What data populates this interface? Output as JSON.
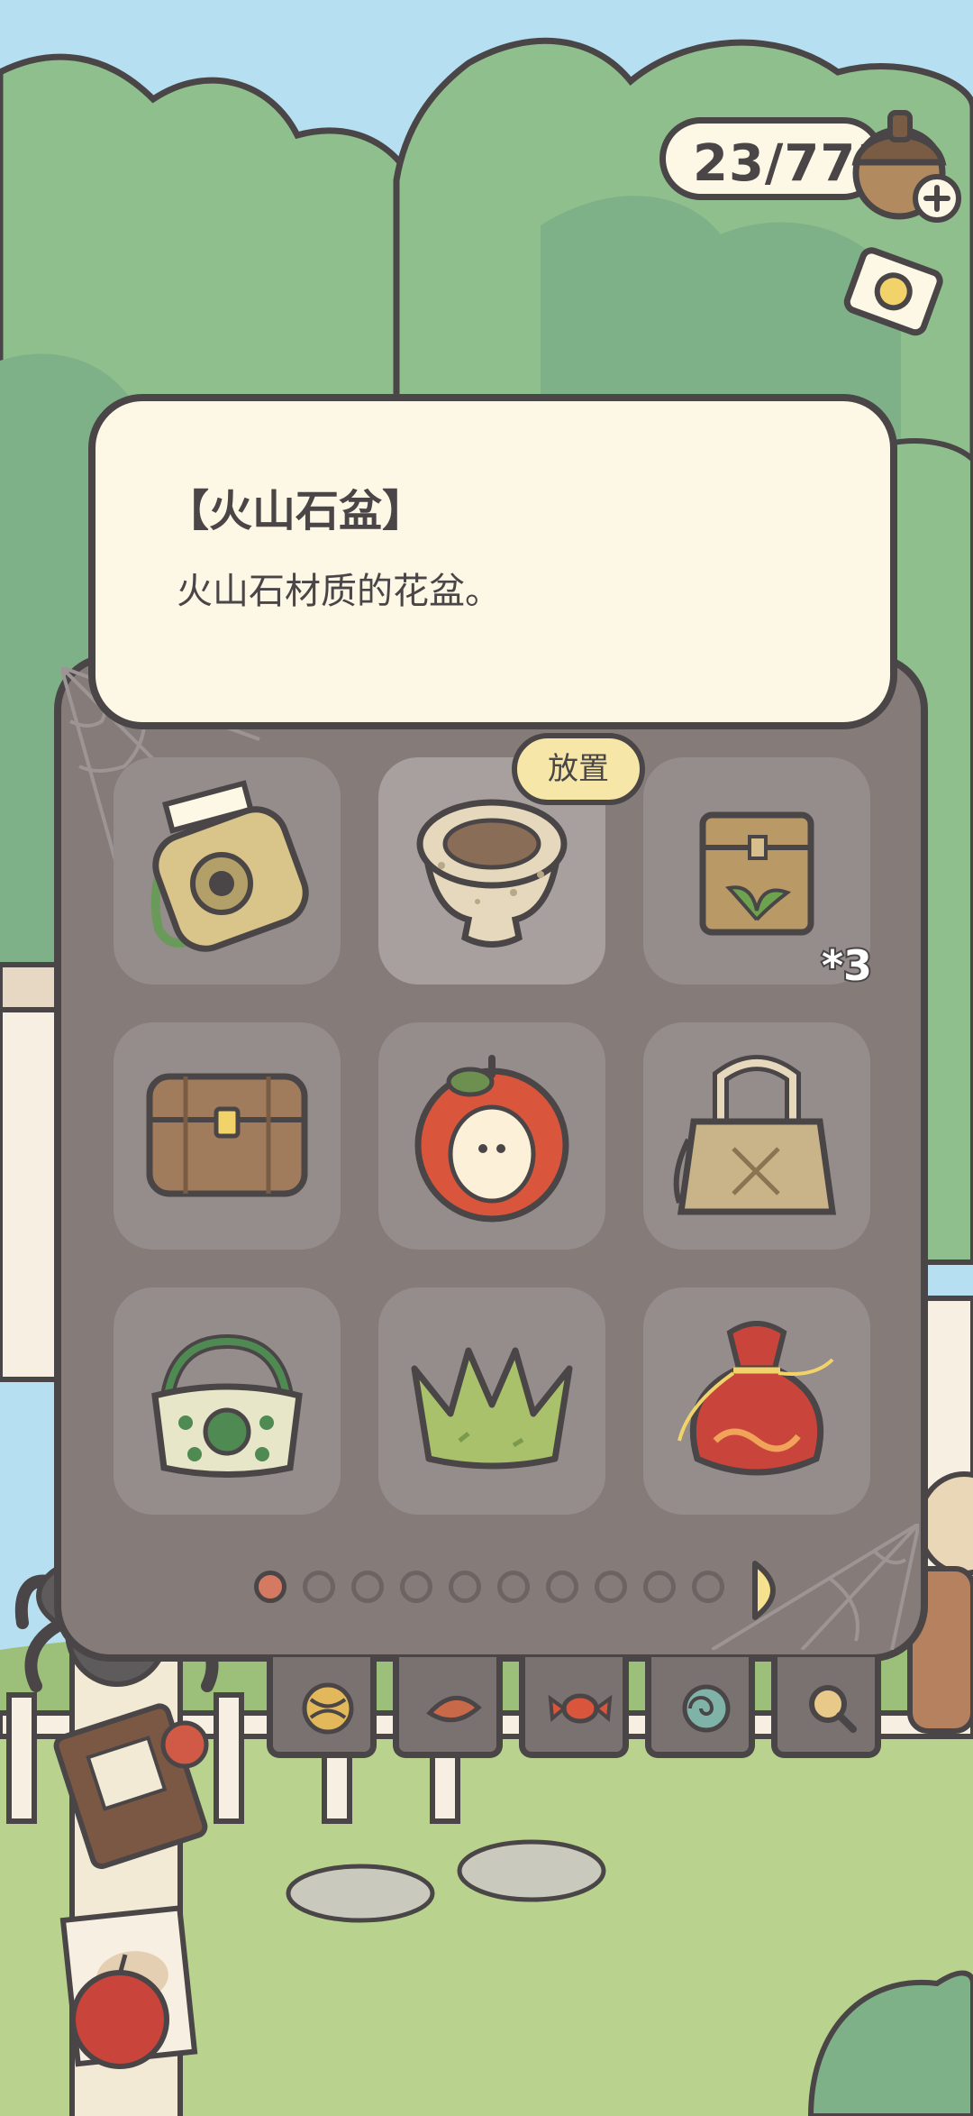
{
  "currency": {
    "value": "23/773"
  },
  "tooltip": {
    "title": "【火山石盆】",
    "description": "火山石材质的花盆。"
  },
  "inventory": {
    "place_label": "放置",
    "items": [
      {
        "icon": "instant-camera-icon",
        "count": ""
      },
      {
        "icon": "volcanic-stone-pot-icon",
        "count": "",
        "selected": true
      },
      {
        "icon": "seed-bag-icon",
        "count": "*3"
      },
      {
        "icon": "wooden-chest-icon",
        "count": ""
      },
      {
        "icon": "apple-icon",
        "count": ""
      },
      {
        "icon": "woven-handbag-icon",
        "count": ""
      },
      {
        "icon": "green-tote-bag-icon",
        "count": ""
      },
      {
        "icon": "leaf-crown-icon",
        "count": ""
      },
      {
        "icon": "red-pouch-icon",
        "count": ""
      }
    ],
    "pages_total": 10,
    "current_page": 1
  },
  "category_tabs": [
    {
      "icon": "yarn-ball-icon"
    },
    {
      "icon": "leaf-icon"
    },
    {
      "icon": "candy-icon"
    },
    {
      "icon": "snail-shell-icon"
    },
    {
      "icon": "magnifier-icon"
    }
  ],
  "colors": {
    "outline": "#4a4546",
    "panel": "#857c7a",
    "tooltip_bg": "#fdf8e6",
    "place_button": "#f6e6a8",
    "sky": "#b7dff2",
    "foliage": "#8fbf8d"
  }
}
